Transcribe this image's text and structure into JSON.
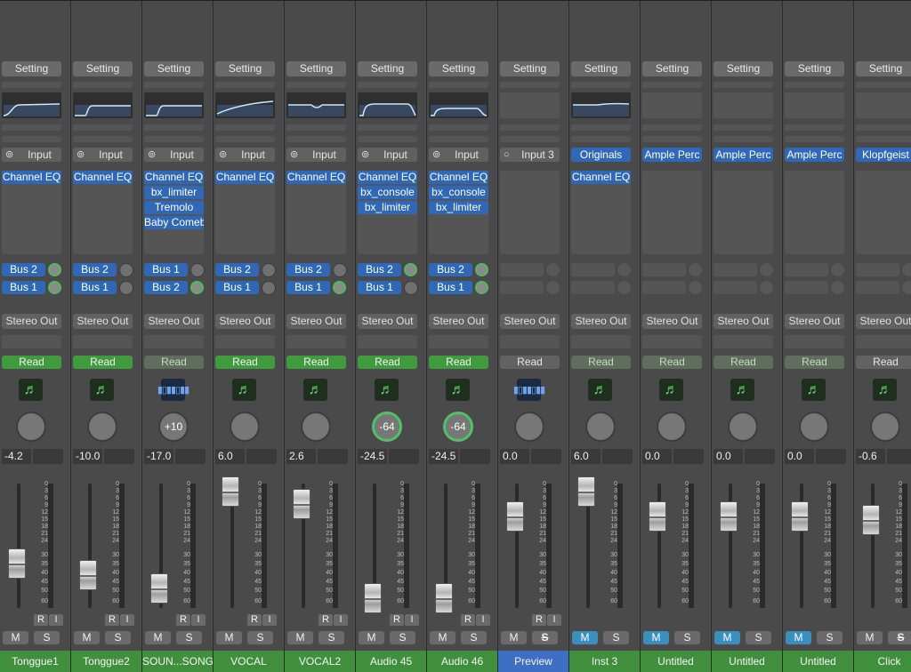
{
  "strips": [
    {
      "setting": "Setting",
      "eq": "curve1",
      "input_label": "Input",
      "input_type": "stereo",
      "plugins": [
        "Channel EQ"
      ],
      "sends": [
        {
          "label": "Bus 2",
          "knob": "active"
        },
        {
          "label": "Bus 1",
          "knob": "active"
        }
      ],
      "output": "Stereo Out",
      "automation": "Read",
      "auto_style": "read",
      "icon": "audio-note-icon",
      "pan": "",
      "pan_ring": false,
      "volume": "-4.2",
      "fader_level": 0.37,
      "r": "R",
      "i": "I",
      "mute": "M",
      "solo": "S",
      "mute_on": false,
      "solo_sym": false,
      "name": "Tonggue1",
      "name_color": "green"
    },
    {
      "setting": "Setting",
      "eq": "curve2",
      "input_label": "Input",
      "input_type": "stereo",
      "plugins": [
        "Channel EQ"
      ],
      "sends": [
        {
          "label": "Bus 2",
          "knob": "plain"
        },
        {
          "label": "Bus 1",
          "knob": "plain"
        }
      ],
      "output": "Stereo Out",
      "automation": "Read",
      "auto_style": "read",
      "icon": "audio-note-icon",
      "pan": "",
      "pan_ring": false,
      "volume": "-10.0",
      "fader_level": 0.28,
      "r": "R",
      "i": "I",
      "mute": "M",
      "solo": "S",
      "mute_on": false,
      "solo_sym": false,
      "name": "Tonggue2",
      "name_color": "green"
    },
    {
      "setting": "Setting",
      "eq": "curve2",
      "input_label": "Input",
      "input_type": "stereo",
      "plugins": [
        "Channel EQ",
        "bx_limiter",
        "Tremolo",
        "Baby Comeb"
      ],
      "sends": [
        {
          "label": "Bus 1",
          "knob": "plain"
        },
        {
          "label": "Bus 2",
          "knob": "active"
        }
      ],
      "output": "Stereo Out",
      "automation": "Read",
      "auto_style": "dim",
      "icon": "waveform-icon",
      "pan": "+10",
      "pan_ring": false,
      "volume": "-17.0",
      "fader_level": 0.17,
      "r": "R",
      "i": "I",
      "mute": "M",
      "solo": "S",
      "mute_on": false,
      "solo_sym": false,
      "name": "SOUN...SONG",
      "name_color": "green"
    },
    {
      "setting": "Setting",
      "eq": "curve3",
      "input_label": "Input",
      "input_type": "stereo",
      "plugins": [
        "Channel EQ"
      ],
      "sends": [
        {
          "label": "Bus 2",
          "knob": "plain"
        },
        {
          "label": "Bus 1",
          "knob": "plain"
        }
      ],
      "output": "Stereo Out",
      "automation": "Read",
      "auto_style": "read",
      "icon": "audio-note-icon",
      "pan": "",
      "pan_ring": false,
      "volume": "6.0",
      "fader_level": 0.95,
      "r": "R",
      "i": "I",
      "mute": "M",
      "solo": "S",
      "mute_on": false,
      "solo_sym": false,
      "name": "VOCAL",
      "name_color": "green"
    },
    {
      "setting": "Setting",
      "eq": "curve4",
      "input_label": "Input",
      "input_type": "stereo",
      "plugins": [
        "Channel EQ"
      ],
      "sends": [
        {
          "label": "Bus 2",
          "knob": "plain"
        },
        {
          "label": "Bus 1",
          "knob": "active"
        }
      ],
      "output": "Stereo Out",
      "automation": "Read",
      "auto_style": "read",
      "icon": "audio-note-icon",
      "pan": "",
      "pan_ring": false,
      "volume": "2.6",
      "fader_level": 0.85,
      "r": "R",
      "i": "I",
      "mute": "M",
      "solo": "S",
      "mute_on": false,
      "solo_sym": false,
      "name": "VOCAL2",
      "name_color": "green"
    },
    {
      "setting": "Setting",
      "eq": "curve5",
      "input_label": "Input",
      "input_type": "stereo",
      "plugins": [
        "Channel EQ",
        "bx_console",
        "bx_limiter"
      ],
      "sends": [
        {
          "label": "Bus 2",
          "knob": "active"
        },
        {
          "label": "Bus 1",
          "knob": "plain"
        }
      ],
      "output": "Stereo Out",
      "automation": "Read",
      "auto_style": "read",
      "icon": "audio-note-icon",
      "pan": "-64",
      "pan_ring": true,
      "volume": "-24.5",
      "fader_level": 0.09,
      "r": "R",
      "i": "I",
      "mute": "M",
      "solo": "S",
      "mute_on": false,
      "solo_sym": false,
      "name": "Audio 45",
      "name_color": "green"
    },
    {
      "setting": "Setting",
      "eq": "curve6",
      "input_label": "Input",
      "input_type": "stereo",
      "plugins": [
        "Channel EQ",
        "bx_console",
        "bx_limiter"
      ],
      "sends": [
        {
          "label": "Bus 2",
          "knob": "active"
        },
        {
          "label": "Bus 1",
          "knob": "active"
        }
      ],
      "output": "Stereo Out",
      "automation": "Read",
      "auto_style": "read",
      "icon": "audio-note-icon",
      "pan": "-64",
      "pan_ring": true,
      "volume": "-24.5",
      "fader_level": 0.09,
      "r": "R",
      "i": "I",
      "mute": "M",
      "solo": "S",
      "mute_on": false,
      "solo_sym": false,
      "name": "Audio 46",
      "name_color": "green"
    },
    {
      "setting": "Setting",
      "eq": "empty",
      "input_label": "Input 3",
      "input_type": "mono",
      "plugins": [],
      "sends": [
        {
          "label": "",
          "knob": "empty"
        },
        {
          "label": "",
          "knob": "empty"
        }
      ],
      "output": "Stereo Out",
      "automation": "Read",
      "auto_style": "grey",
      "icon": "waveform-icon",
      "pan": "",
      "pan_ring": false,
      "volume": "0.0",
      "fader_level": 0.75,
      "r": "R",
      "i": "I",
      "mute": "M",
      "solo": "S",
      "mute_on": false,
      "solo_sym": true,
      "name": "Preview",
      "name_color": "blue"
    },
    {
      "setting": "Setting",
      "eq": "curve7",
      "input_label": "Originals",
      "input_type": "inst",
      "plugins": [
        "Channel EQ"
      ],
      "sends": [
        {
          "label": "",
          "knob": "empty"
        },
        {
          "label": "",
          "knob": "empty"
        }
      ],
      "output": "Stereo Out",
      "automation": "Read",
      "auto_style": "dim",
      "icon": "audio-note-icon",
      "pan": "",
      "pan_ring": false,
      "volume": "6.0",
      "fader_level": 0.95,
      "r": "",
      "i": "",
      "mute": "M",
      "solo": "S",
      "mute_on": true,
      "solo_sym": false,
      "name": "Inst 3",
      "name_color": "green"
    },
    {
      "setting": "Setting",
      "eq": "empty",
      "input_label": "Ample Perc",
      "input_type": "inst",
      "plugins": [],
      "sends": [
        {
          "label": "",
          "knob": "empty"
        },
        {
          "label": "",
          "knob": "empty"
        }
      ],
      "output": "Stereo Out",
      "automation": "Read",
      "auto_style": "dim",
      "icon": "audio-note-icon",
      "pan": "",
      "pan_ring": false,
      "volume": "0.0",
      "fader_level": 0.75,
      "r": "",
      "i": "",
      "mute": "M",
      "solo": "S",
      "mute_on": true,
      "solo_sym": false,
      "name": "Untitled",
      "name_color": "green"
    },
    {
      "setting": "Setting",
      "eq": "empty",
      "input_label": "Ample Perc",
      "input_type": "inst",
      "plugins": [],
      "sends": [
        {
          "label": "",
          "knob": "empty"
        },
        {
          "label": "",
          "knob": "empty"
        }
      ],
      "output": "Stereo Out",
      "automation": "Read",
      "auto_style": "dim",
      "icon": "audio-note-icon",
      "pan": "",
      "pan_ring": false,
      "volume": "0.0",
      "fader_level": 0.75,
      "r": "",
      "i": "",
      "mute": "M",
      "solo": "S",
      "mute_on": true,
      "solo_sym": false,
      "name": "Untitled",
      "name_color": "green"
    },
    {
      "setting": "Setting",
      "eq": "empty",
      "input_label": "Ample Perc",
      "input_type": "inst",
      "plugins": [],
      "sends": [
        {
          "label": "",
          "knob": "empty"
        },
        {
          "label": "",
          "knob": "empty"
        }
      ],
      "output": "Stereo Out",
      "automation": "Read",
      "auto_style": "dim",
      "icon": "audio-note-icon",
      "pan": "",
      "pan_ring": false,
      "volume": "0.0",
      "fader_level": 0.75,
      "r": "",
      "i": "",
      "mute": "M",
      "solo": "S",
      "mute_on": true,
      "solo_sym": false,
      "name": "Untitled",
      "name_color": "green"
    },
    {
      "setting": "Setting",
      "eq": "empty",
      "input_label": "Klopfgeist",
      "input_type": "inst",
      "plugins": [],
      "sends": [
        {
          "label": "",
          "knob": "empty"
        },
        {
          "label": "",
          "knob": "empty"
        }
      ],
      "output": "Stereo Out",
      "automation": "Read",
      "auto_style": "grey",
      "icon": "audio-note-icon",
      "pan": "",
      "pan_ring": false,
      "volume": "-0.6",
      "fader_level": 0.72,
      "r": "",
      "i": "",
      "mute": "M",
      "solo": "S",
      "mute_on": false,
      "solo_sym": true,
      "name": "Click",
      "name_color": "green"
    }
  ],
  "fader_scale": [
    "0",
    "3",
    "6",
    "9",
    "12",
    "15",
    "18",
    "21",
    "24",
    "30",
    "35",
    "40",
    "45",
    "50",
    "60"
  ]
}
